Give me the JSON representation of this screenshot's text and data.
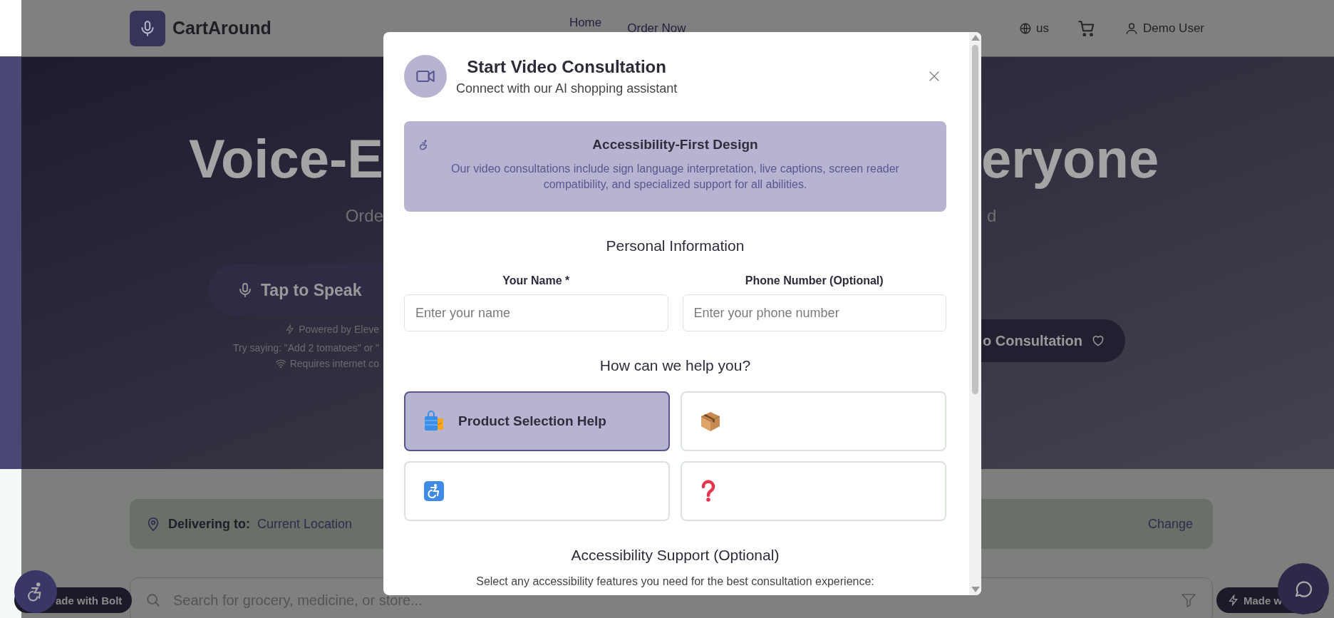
{
  "header": {
    "brand": "CartAround",
    "nav": [
      {
        "label": "Home"
      },
      {
        "label": "Order Now"
      }
    ],
    "region": "us",
    "user": "Demo User"
  },
  "hero": {
    "title_left": "Voice-E",
    "title_right": "eryone",
    "subtitle_left": "Orde",
    "subtitle_right": "d",
    "speak_button": "Tap to Speak",
    "powered_by": "Powered by Eleve",
    "hint": "Try saying: \"Add 2 tomatoes\" or \"",
    "requirement": "Requires internet co",
    "consult_button": "o Consultation"
  },
  "delivery": {
    "label": "Delivering to:",
    "location": "Current Location",
    "action": "Change"
  },
  "search": {
    "placeholder": "Search for grocery, medicine, or store..."
  },
  "badges": [
    {
      "label": "ade with Bolt"
    },
    {
      "label": "Made w"
    }
  ],
  "modal": {
    "title": "Start Video Consultation",
    "subtitle": "Connect with our AI shopping assistant",
    "notice": {
      "title": "Accessibility-First Design",
      "text": "Our video consultations include sign language interpretation, live captions, screen reader compatibility, and specialized support for all abilities."
    },
    "personal_title": "Personal Information",
    "fields": [
      {
        "label": "Your Name *",
        "placeholder": "Enter your name"
      },
      {
        "label": "Phone Number (Optional)",
        "placeholder": "Enter your phone number"
      }
    ],
    "help_title": "How can we help you?",
    "options": [
      {
        "kind": "bag",
        "label": "Product Selection Help",
        "selected": true
      },
      {
        "kind": "box",
        "selected": false
      },
      {
        "kind": "wheelchair",
        "selected": false
      },
      {
        "kind": "question",
        "selected": false
      }
    ],
    "accessibility_title": "Accessibility Support (Optional)",
    "accessibility_text": "Select any accessibility features you need for the best consultation experience:"
  }
}
